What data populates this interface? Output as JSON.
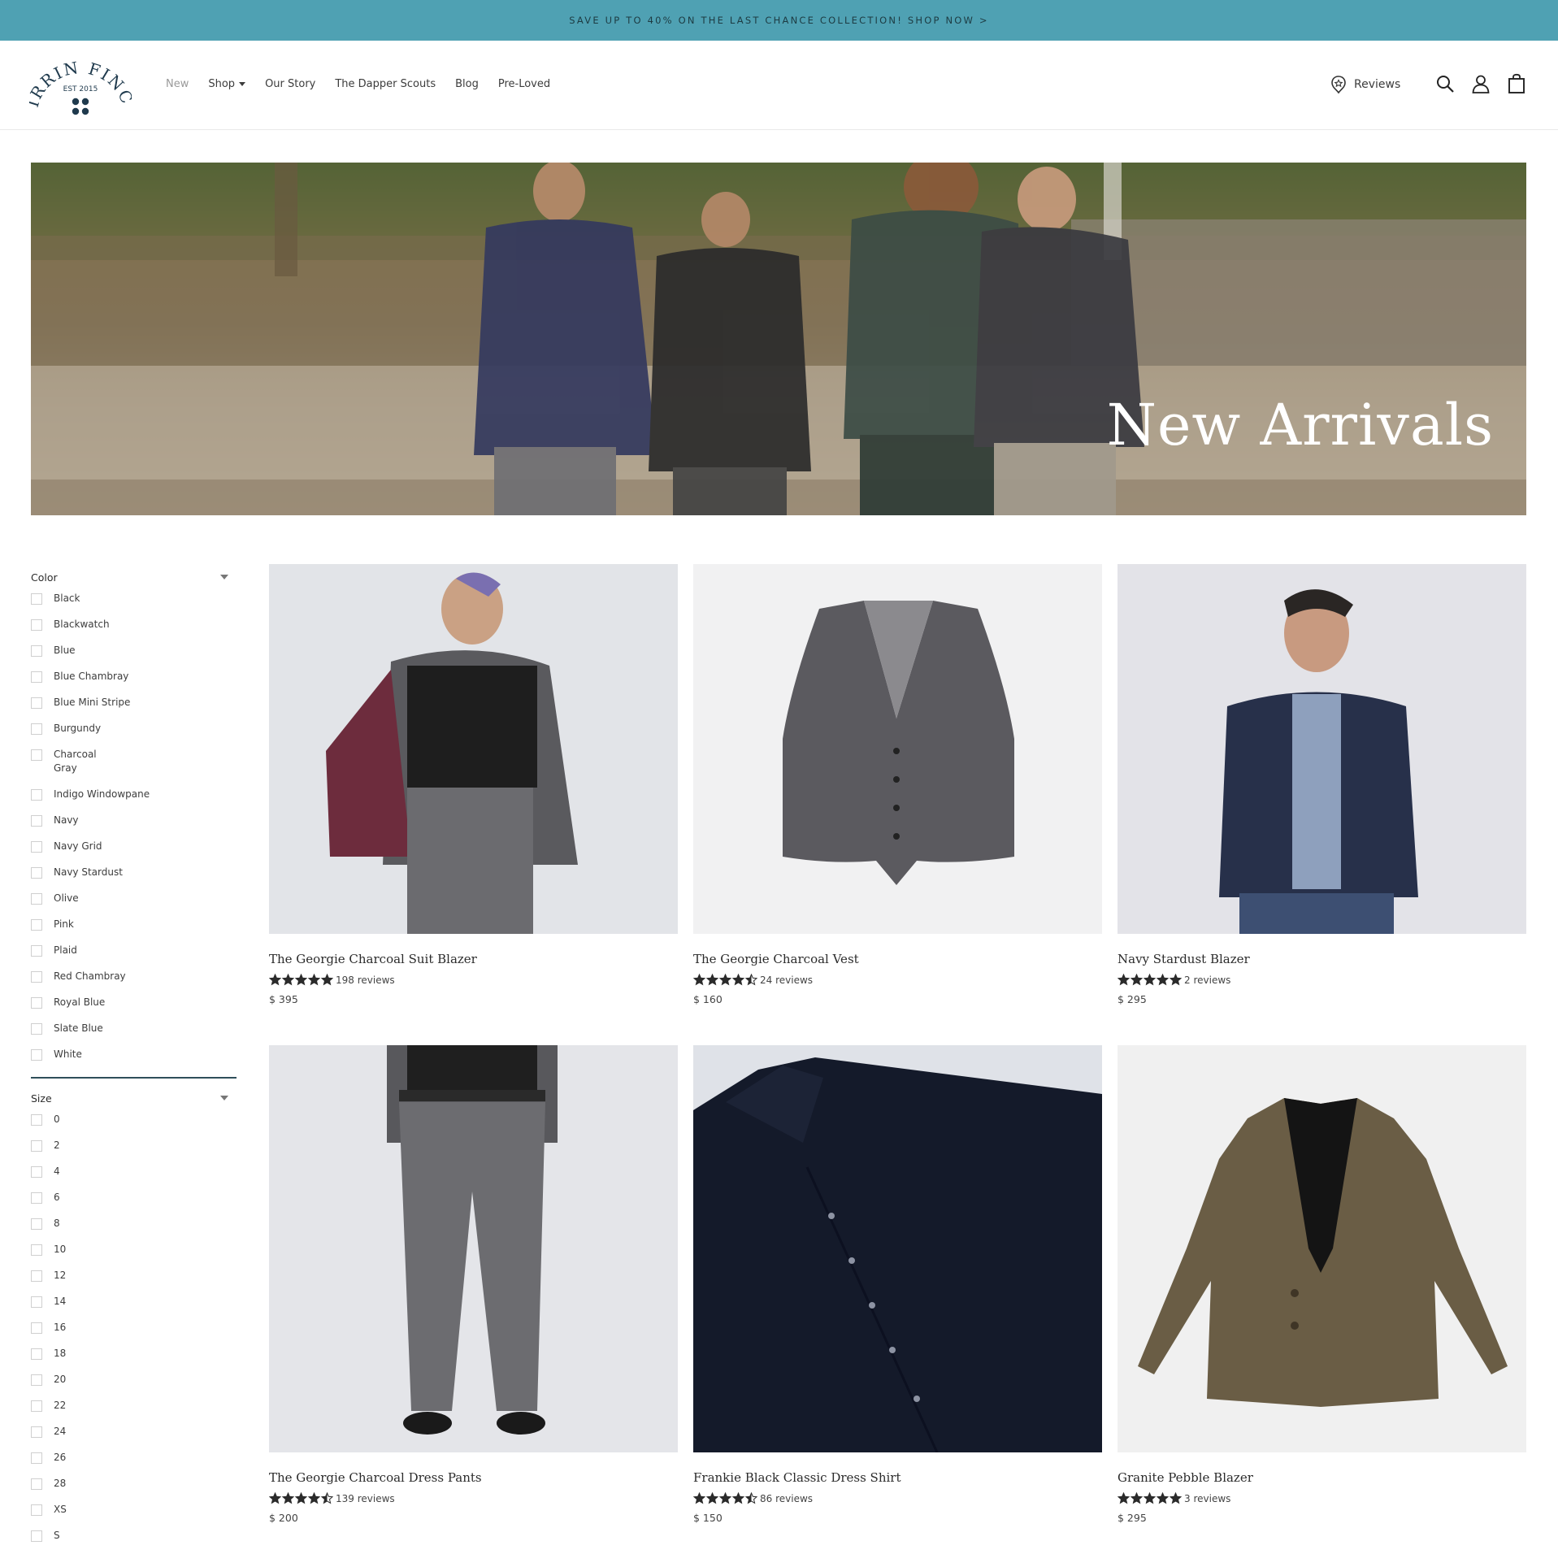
{
  "announcement": "SAVE UP TO 40% ON THE LAST CHANCE COLLECTION! SHOP NOW >",
  "brand": {
    "name": "KIRRIN FINCH",
    "established": "EST 2015"
  },
  "nav": [
    {
      "label": "New"
    },
    {
      "label": "Shop"
    },
    {
      "label": "Our Story"
    },
    {
      "label": "The Dapper Scouts"
    },
    {
      "label": "Blog"
    },
    {
      "label": "Pre-Loved"
    }
  ],
  "header_links": {
    "reviews": "Reviews"
  },
  "hero": {
    "title": "New Arrivals"
  },
  "filters": {
    "color": {
      "title": "Color",
      "options": [
        "Black",
        "Blackwatch",
        "Blue",
        "Blue Chambray",
        "Blue Mini Stripe",
        "Burgundy",
        "Charcoal Gray",
        "Indigo Windowpane",
        "Navy",
        "Navy Grid",
        "Navy Stardust",
        "Olive",
        "Pink",
        "Plaid",
        "Red Chambray",
        "Royal Blue",
        "Slate Blue",
        "White"
      ]
    },
    "size": {
      "title": "Size",
      "options": [
        "0",
        "2",
        "4",
        "6",
        "8",
        "10",
        "12",
        "14",
        "16",
        "18",
        "20",
        "22",
        "24",
        "26",
        "28",
        "XS",
        "S"
      ]
    }
  },
  "products": [
    {
      "name": "The Georgie Charcoal Suit Blazer",
      "rating": 5,
      "reviews": "198 reviews",
      "price": "$ 395"
    },
    {
      "name": "The Georgie Charcoal Vest",
      "rating": 4.5,
      "reviews": "24 reviews",
      "price": "$ 160"
    },
    {
      "name": "Navy Stardust Blazer",
      "rating": 5,
      "reviews": "2 reviews",
      "price": "$ 295"
    },
    {
      "name": "The Georgie Charcoal Dress Pants",
      "rating": 4.5,
      "reviews": "139 reviews",
      "price": "$ 200"
    },
    {
      "name": "Frankie Black Classic Dress Shirt",
      "rating": 4.5,
      "reviews": "86 reviews",
      "price": "$ 150"
    },
    {
      "name": "Granite Pebble Blazer",
      "rating": 5,
      "reviews": "3 reviews",
      "price": "$ 295"
    }
  ],
  "colors": {
    "announcement_bg": "#4fa1b3",
    "brand_navy": "#1f3a4d",
    "divider": "#2f4f5a"
  }
}
